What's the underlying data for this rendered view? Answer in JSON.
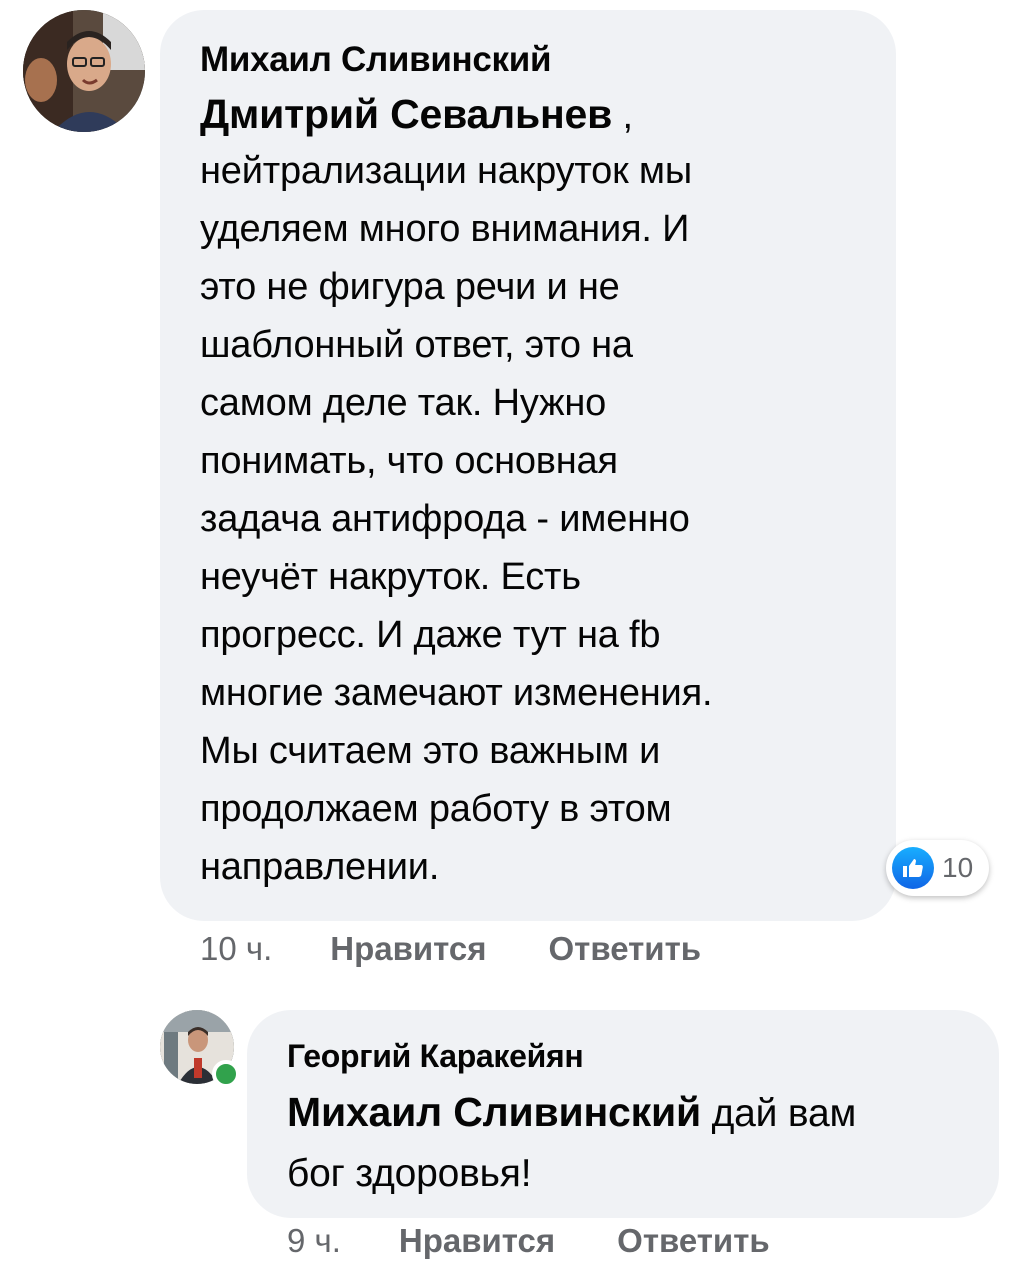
{
  "comment": {
    "author": "Михаил Сливинский",
    "mention": "Дмитрий Севальнев",
    "mention_suffix": " ,",
    "lines": [
      "нейтрализации накруток мы",
      "уделяем много внимания. И",
      "это не фигура речи и не",
      "шаблонный ответ, это на",
      "самом деле так. Нужно",
      "понимать, что основная",
      "задача антифрода - именно",
      "неучёт накруток. Есть",
      "прогресс. И даже тут на fb",
      "многие замечают изменения.",
      "Мы считаем это важным и",
      "продолжаем работу в этом",
      "направлении."
    ],
    "reaction_count": "10",
    "time": "10 ч.",
    "like_label": "Нравится",
    "reply_label": "Ответить"
  },
  "reply": {
    "author": "Георгий Каракейян",
    "mention": "Михаил Сливинский",
    "text_after_mention": " дай вам",
    "text_line2": "бог здоровья!",
    "time": "9 ч.",
    "like_label": "Нравится",
    "reply_label": "Ответить"
  },
  "colors": {
    "bubble": "#f0f2f5",
    "meta_text": "#65676b",
    "like_blue": "#1877f2",
    "online_green": "#31a24c"
  },
  "icons": {
    "reaction": "thumbs-up-icon",
    "presence": "online-status-icon"
  }
}
